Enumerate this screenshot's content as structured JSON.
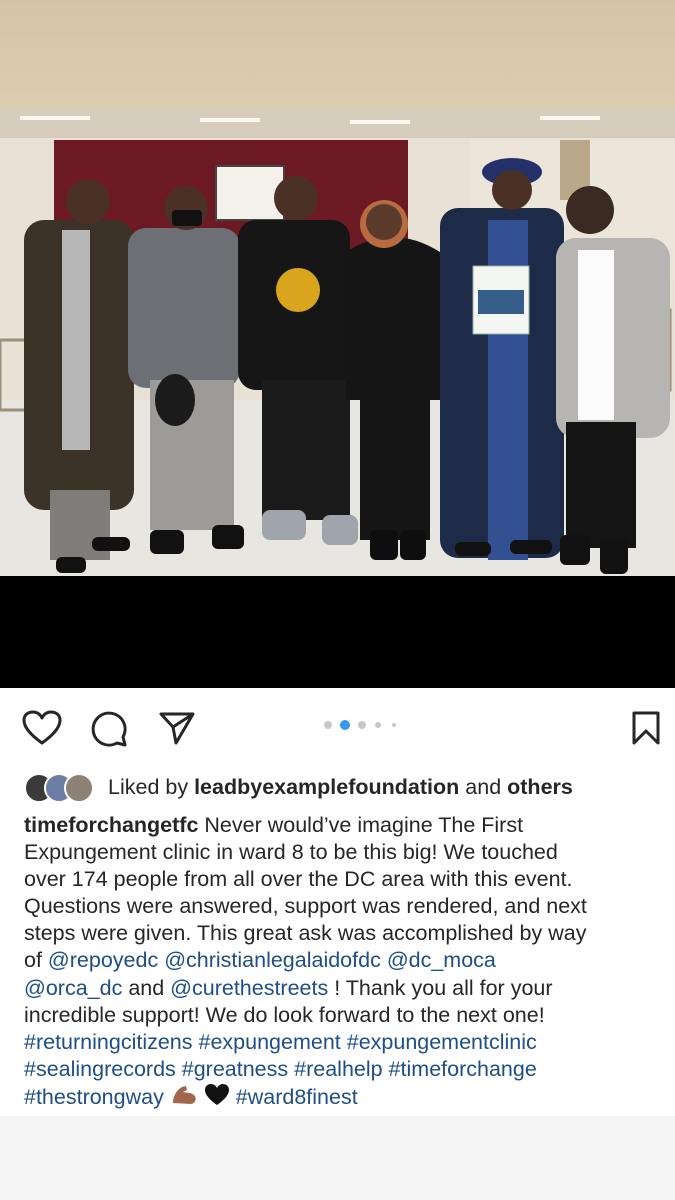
{
  "post": {
    "photo_alt": "Group photo",
    "carousel": {
      "count": 5,
      "active_index": 1
    }
  },
  "likes": {
    "prefix": "Liked by",
    "user": "leadbyexamplefoundation",
    "conjunction": "and",
    "others": "others"
  },
  "caption": {
    "username": "timeforchangetfc",
    "line1": "Never would’ve imagine The First",
    "line2": "Expungement clinic in ward 8 to be this big! We touched",
    "line3": "over 174 people from all over the DC area with this event.",
    "line4": "Questions were answered, support was rendered, and next",
    "line5": "steps were given. This great ask was accomplished by way",
    "line6_prefix": "of",
    "mention_repoyedc": "@repoyedc",
    "mention_christianlegalaidofdc": "@christianlegalaidofdc",
    "mention_dc_moca": "@dc_moca",
    "mention_orca_dc": "@orca_dc",
    "and": "and",
    "mention_curethestreets": "@curethestreets",
    "line7_suffix": "! Thank you all for your",
    "line8": "incredible support! We do look forward to the next one!",
    "hashtag_returningcitizens": "#returningcitizens",
    "hashtag_expungement": "#expungement",
    "hashtag_expungementclinic": "#expungementclinic",
    "hashtag_sealingrecords": "#sealingrecords",
    "hashtag_greatness": "#greatness",
    "hashtag_realhelp": "#realhelp",
    "hashtag_timeforchange": "#timeforchange",
    "hashtag_thestrongway": "#thestrongway",
    "hashtag_ward8finest": "#ward8finest",
    "emoji_flexed_biceps": "💪🏾",
    "emoji_black_heart": "🖤"
  },
  "colors": {
    "link": "#1d4e89",
    "text": "#262626",
    "carousel_active": "#3897f0",
    "carousel_inactive": "#c7c7c7"
  },
  "icons": {
    "like": "heart-icon",
    "comment": "comment-icon",
    "share": "send-icon",
    "save": "bookmark-icon"
  }
}
